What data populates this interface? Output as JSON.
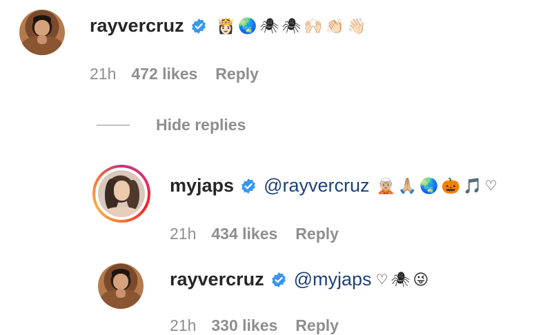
{
  "comments": [
    {
      "username": "rayvercruz",
      "mention": "",
      "emojis": [
        "👸🏻",
        "🌏",
        "🕷",
        "🕷",
        "🙌🏻",
        "👏🏻",
        "👋🏻"
      ],
      "time": "21h",
      "likes": "472 likes",
      "reply": "Reply"
    },
    {
      "username": "myjaps",
      "mention": "@rayvercruz",
      "emojis": [
        "🧝🏼",
        "🙏🏼",
        "🌏",
        "🎃",
        "🎵",
        "♡"
      ],
      "time": "21h",
      "likes": "434 likes",
      "reply": "Reply"
    },
    {
      "username": "rayvercruz",
      "mention": "@myjaps",
      "emojis": [
        "♡",
        "🕷",
        "😜"
      ],
      "time": "21h",
      "likes": "330 likes",
      "reply": "Reply"
    }
  ],
  "thread": {
    "hide_replies": "Hide replies"
  },
  "colors": {
    "verified": "#3897f0",
    "meta": "#8e8e8e",
    "mention": "#1d3f7a"
  }
}
